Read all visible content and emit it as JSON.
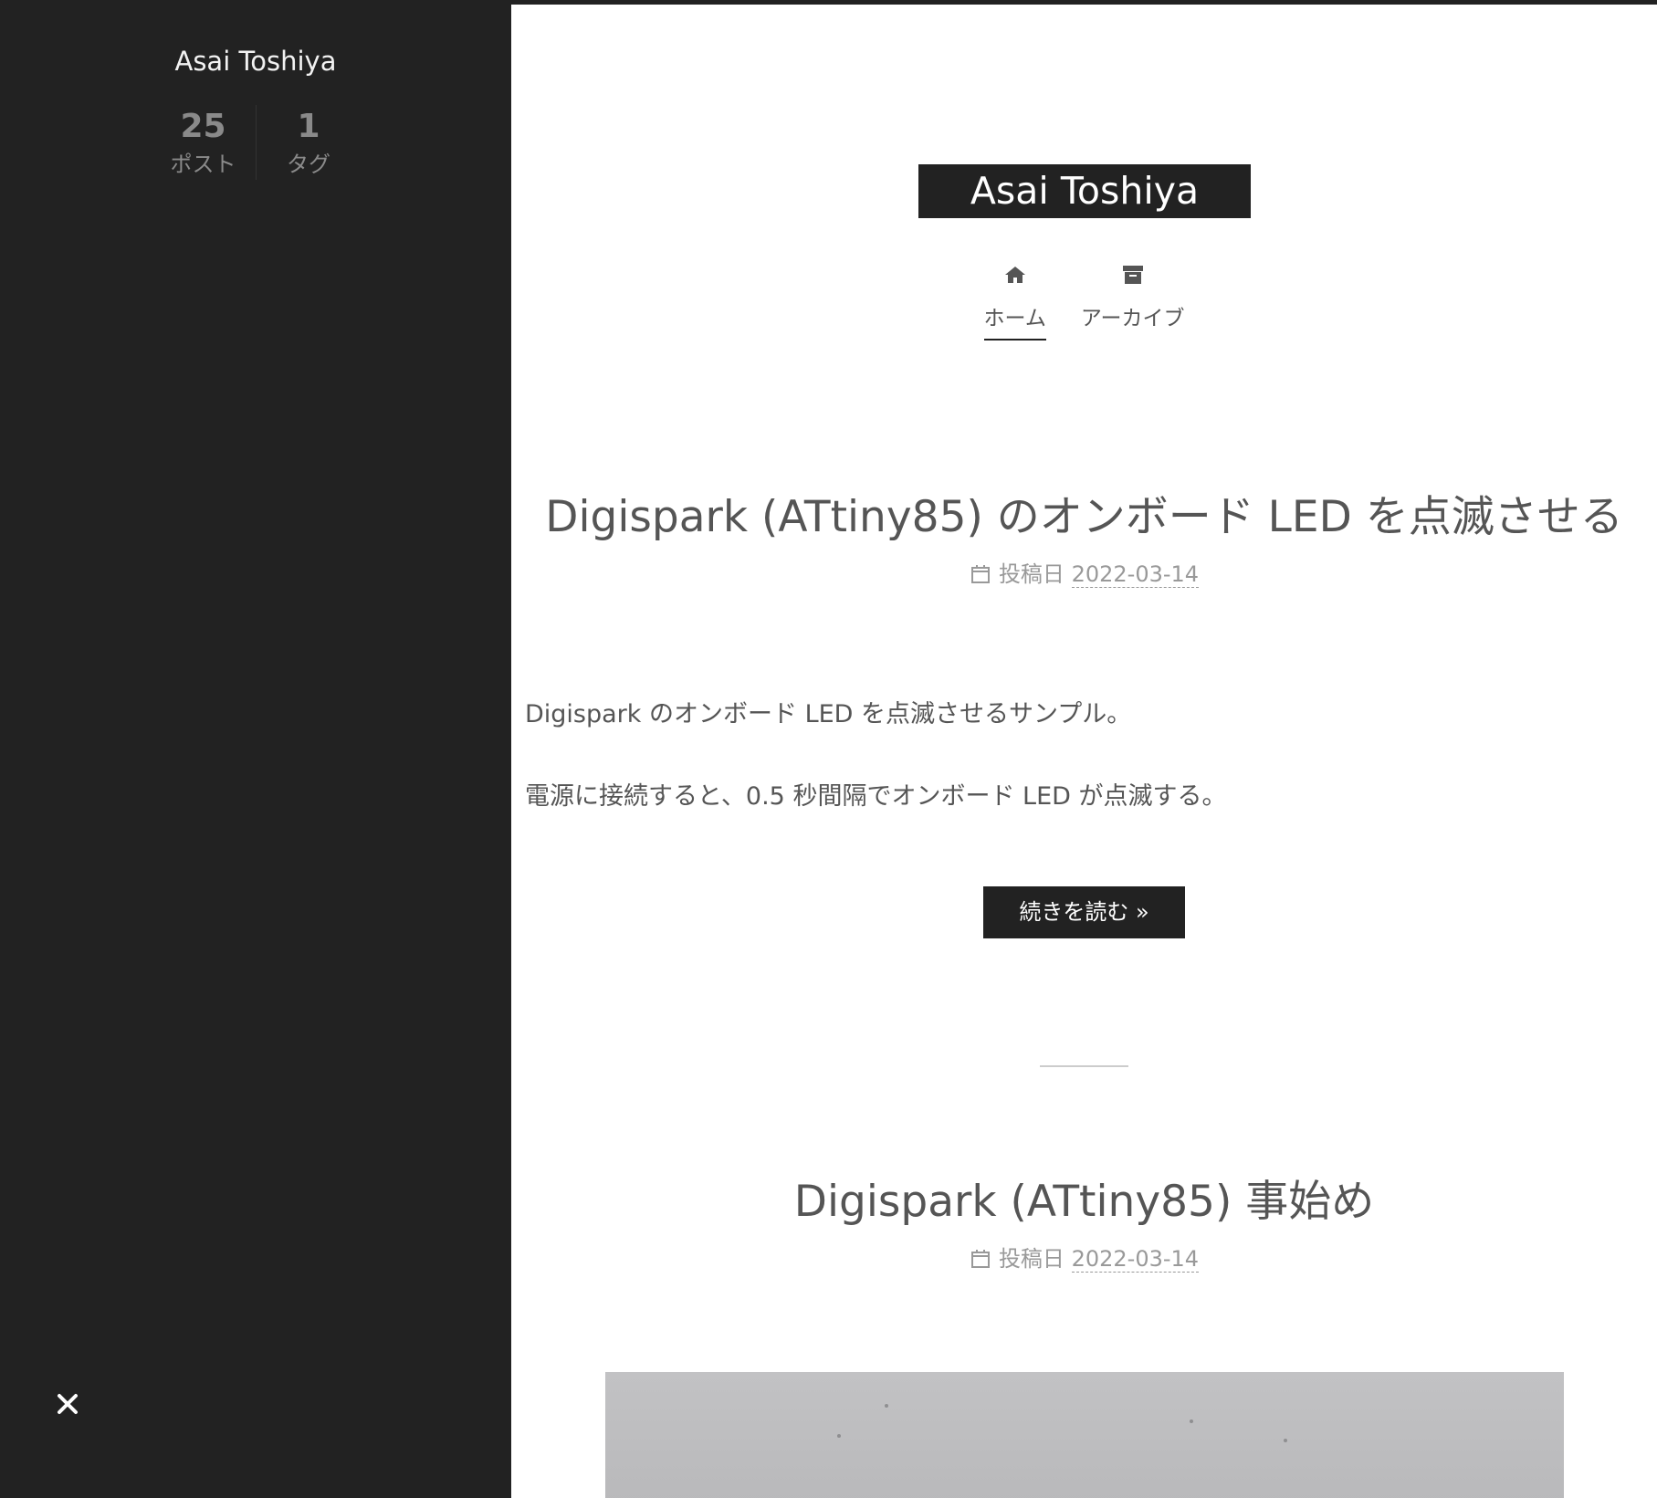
{
  "sidebar": {
    "author": "Asai Toshiya",
    "stats": [
      {
        "count": "25",
        "label": "ポスト"
      },
      {
        "count": "1",
        "label": "タグ"
      }
    ],
    "close_icon": "close-icon"
  },
  "header": {
    "brand": "Asai Toshiya",
    "menu": [
      {
        "label": "ホーム",
        "icon": "home-icon",
        "active": true
      },
      {
        "label": "アーカイブ",
        "icon": "archive-icon",
        "active": false
      }
    ]
  },
  "posts": [
    {
      "title": "Digispark (ATtiny85) のオンボード LED を点滅させる",
      "meta_label": "投稿日",
      "date": "2022-03-14",
      "paragraphs": [
        "Digispark のオンボード LED を点滅させるサンプル。",
        "電源に接続すると、0.5 秒間隔でオンボード LED が点滅する。"
      ],
      "read_more": "続きを読む »"
    },
    {
      "title": "Digispark (ATtiny85) 事始め",
      "meta_label": "投稿日",
      "date": "2022-03-14"
    }
  ],
  "colors": {
    "sidebar_bg": "#222222",
    "text": "#555555",
    "meta": "#999999"
  }
}
